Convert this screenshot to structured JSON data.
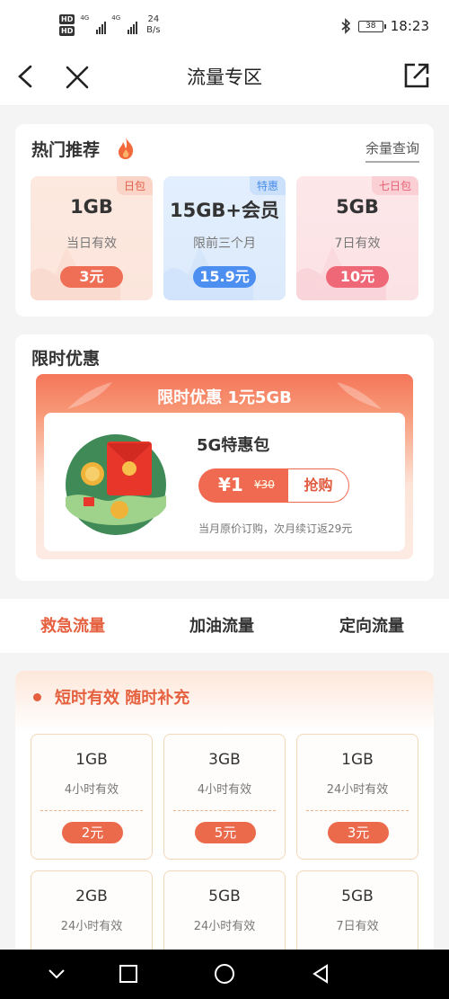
{
  "status_bar": {
    "hd1": "HD",
    "hd2": "HD",
    "net1": "4G",
    "net2": "4G",
    "speed_value": "24",
    "speed_unit": "B/s",
    "battery": "38",
    "time": "18:23",
    "icons": [
      "bluetooth-icon",
      "battery-icon",
      "signal-icon"
    ]
  },
  "header": {
    "title": "流量专区",
    "icons": [
      "back-icon",
      "close-icon",
      "share-icon"
    ]
  },
  "hot": {
    "title": "热门推荐",
    "icon": "fire-icon",
    "link": "余量查询",
    "packages": [
      {
        "badge": "日包",
        "amount": "1GB",
        "validity": "当日有效",
        "price": "3元"
      },
      {
        "badge": "特惠",
        "amount": "15GB+会员",
        "validity": "限前三个月",
        "price": "15.9元"
      },
      {
        "badge": "七日包",
        "amount": "5GB",
        "validity": "7日有效",
        "price": "10元"
      }
    ],
    "colors": {
      "orange": "#ef6f56",
      "blue": "#4c8ff0",
      "pink": "#ef6877"
    }
  },
  "limited": {
    "title": "限时优惠",
    "banner": "限时优惠 1元5GB",
    "package_name": "5G特惠包",
    "price": "¥1",
    "original_price": "¥30",
    "buy_label": "抢购",
    "note": "当月原价订购，次月续订返29元"
  },
  "tabs": [
    {
      "label": "救急流量",
      "active": true
    },
    {
      "label": "加油流量",
      "active": false
    },
    {
      "label": "定向流量",
      "active": false
    }
  ],
  "short_time": {
    "title": "短时有效 随时补充",
    "items": [
      {
        "amount": "1GB",
        "validity": "4小时有效",
        "price": "2元"
      },
      {
        "amount": "3GB",
        "validity": "4小时有效",
        "price": "5元"
      },
      {
        "amount": "1GB",
        "validity": "24小时有效",
        "price": "3元"
      },
      {
        "amount": "2GB",
        "validity": "24小时有效",
        "price": ""
      },
      {
        "amount": "5GB",
        "validity": "24小时有效",
        "price": ""
      },
      {
        "amount": "5GB",
        "validity": "7日有效",
        "price": ""
      }
    ]
  },
  "navbar": {
    "icons": [
      "nav-down-icon",
      "nav-recent-icon",
      "nav-home-icon",
      "nav-back-icon"
    ]
  },
  "accent": "#e5603f"
}
